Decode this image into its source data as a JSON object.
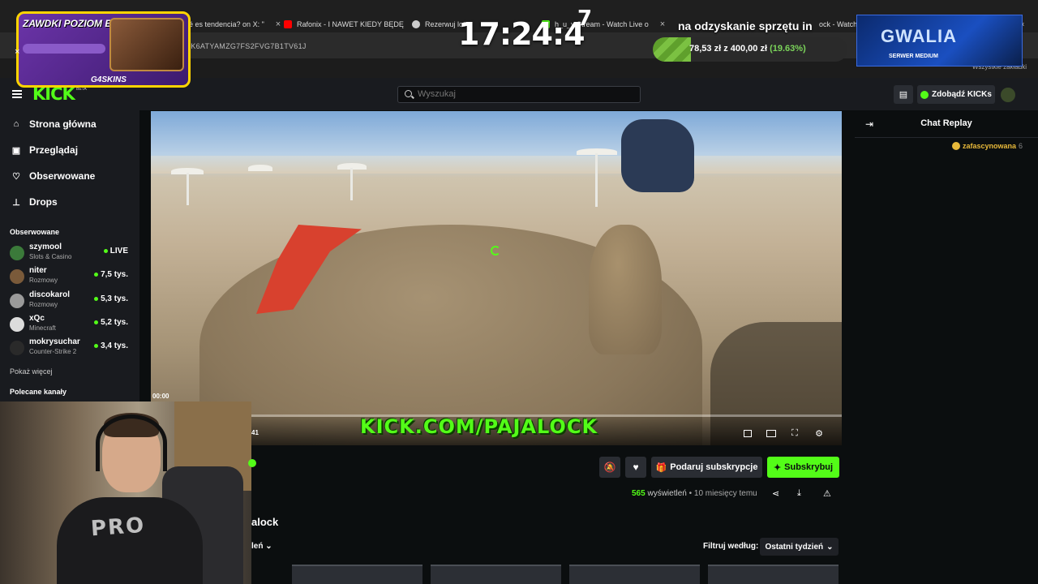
{
  "browser": {
    "tabs": [
      {
        "label": "ué es tendencia? on X: \"",
        "color": "#1da1f2"
      },
      {
        "label": "Rafonix - I NAWET KIEDY BĘDĘ",
        "color": "#ff0000"
      },
      {
        "label": "Rezerwuj lot",
        "color": "#cccccc"
      },
      {
        "label": "h_u_y Stream - Watch Live o",
        "color": "#53fc18"
      },
      {
        "label": "ock - Watch",
        "color": "#53fc18"
      }
    ],
    "address": "1K6ATYAMZG7FS2FVG7B1TV61J",
    "bookmarks_right": "Wszystkie zakładki"
  },
  "overlay": {
    "clock": "17:24:4",
    "clock_sup": "7",
    "goal": {
      "title": "na odzyskanie sprzętu in",
      "current": "78,53 zł",
      "separator": "z",
      "target": "400,00 zł",
      "percent_label": "(19.63%)",
      "progress": 0.1963
    },
    "promo": {
      "title": "ZAWDKI POZIOM EXP",
      "brand": "G4SKINS"
    },
    "server": {
      "name": "GWALIA",
      "subtitle": "SERWER MEDIUM"
    }
  },
  "header": {
    "logo": "KICK",
    "logo_badge": "BETA",
    "search_placeholder": "Wyszukaj",
    "kicks_label": "Zdobądź KICKs"
  },
  "sidebar": {
    "nav": [
      {
        "label": "Strona główna",
        "icon": "home-icon"
      },
      {
        "label": "Przeglądaj",
        "icon": "browse-icon"
      },
      {
        "label": "Obserwowane",
        "icon": "heart-icon"
      },
      {
        "label": "Drops",
        "icon": "drops-icon"
      }
    ],
    "following_title": "Obserwowane",
    "following": [
      {
        "name": "szymool",
        "category": "Slots & Casino",
        "viewers": "LIVE",
        "avatar": "#3b7a3a"
      },
      {
        "name": "niter",
        "category": "Rozmowy",
        "viewers": "7,5 tys.",
        "avatar": "#7a5a3a"
      },
      {
        "name": "discokarol",
        "category": "Rozmowy",
        "viewers": "5,3 tys.",
        "avatar": "#9a9a9a"
      },
      {
        "name": "xQc",
        "category": "Minecraft",
        "viewers": "5,2 tys.",
        "avatar": "#dcdcdc"
      },
      {
        "name": "mokrysuchar",
        "category": "Counter-Strike 2",
        "viewers": "3,4 tys.",
        "avatar": "#2a2a2a"
      }
    ],
    "show_more": "Pokaż więcej",
    "recommended_title": "Polecane kanały"
  },
  "video": {
    "timestamp": "00:00",
    "watermark": "KICK.COM/PAJALOCK",
    "partial_time": "41",
    "progress": 0.0
  },
  "actions": {
    "gift_label": "Podaruj subskrypcje",
    "subscribe_label": "Subskrybuj",
    "views_count": "565",
    "views_word": "wyświetleń",
    "separator": "•",
    "age": "10 miesięcy temu"
  },
  "below": {
    "section_partial": "alock",
    "sort_partial": "leń",
    "filter_label": "Filtruj według:",
    "filter_value": "Ostatni tydzień"
  },
  "chat": {
    "title": "Chat Replay",
    "message_user": "zafascynowana",
    "message_rest": "6"
  },
  "webcam": {
    "shirt_text": "PRO"
  }
}
